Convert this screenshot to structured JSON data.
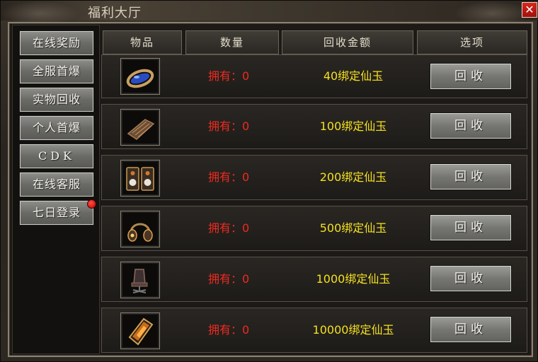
{
  "window": {
    "title": "福利大厅",
    "close_glyph": "✕"
  },
  "sidebar": {
    "items": [
      {
        "label": "在线奖励"
      },
      {
        "label": "全服首爆"
      },
      {
        "label": "实物回收"
      },
      {
        "label": "个人首爆"
      },
      {
        "label": "CDK"
      },
      {
        "label": "在线客服"
      },
      {
        "label": "七日登录",
        "badge": true
      }
    ]
  },
  "table": {
    "headers": [
      "物品",
      "数量",
      "回收金额",
      "选项"
    ],
    "rows": [
      {
        "icon": "blue-ring-icon",
        "owned": "拥有：0",
        "amount": "40绑定仙玉",
        "action": "回收"
      },
      {
        "icon": "keyboard-icon",
        "owned": "拥有：0",
        "amount": "100绑定仙玉",
        "action": "回收"
      },
      {
        "icon": "speakers-icon",
        "owned": "拥有：0",
        "amount": "200绑定仙玉",
        "action": "回收"
      },
      {
        "icon": "headphones-icon",
        "owned": "拥有：0",
        "amount": "500绑定仙玉",
        "action": "回收"
      },
      {
        "icon": "gaming-chair-icon",
        "owned": "拥有：0",
        "amount": "1000绑定仙玉",
        "action": "回收"
      },
      {
        "icon": "smartphone-icon",
        "owned": "拥有：0",
        "amount": "10000绑定仙玉",
        "action": "回收"
      }
    ]
  },
  "colors": {
    "owned": "#ee2a20",
    "amount": "#f4e020",
    "close": "#d8241c"
  }
}
